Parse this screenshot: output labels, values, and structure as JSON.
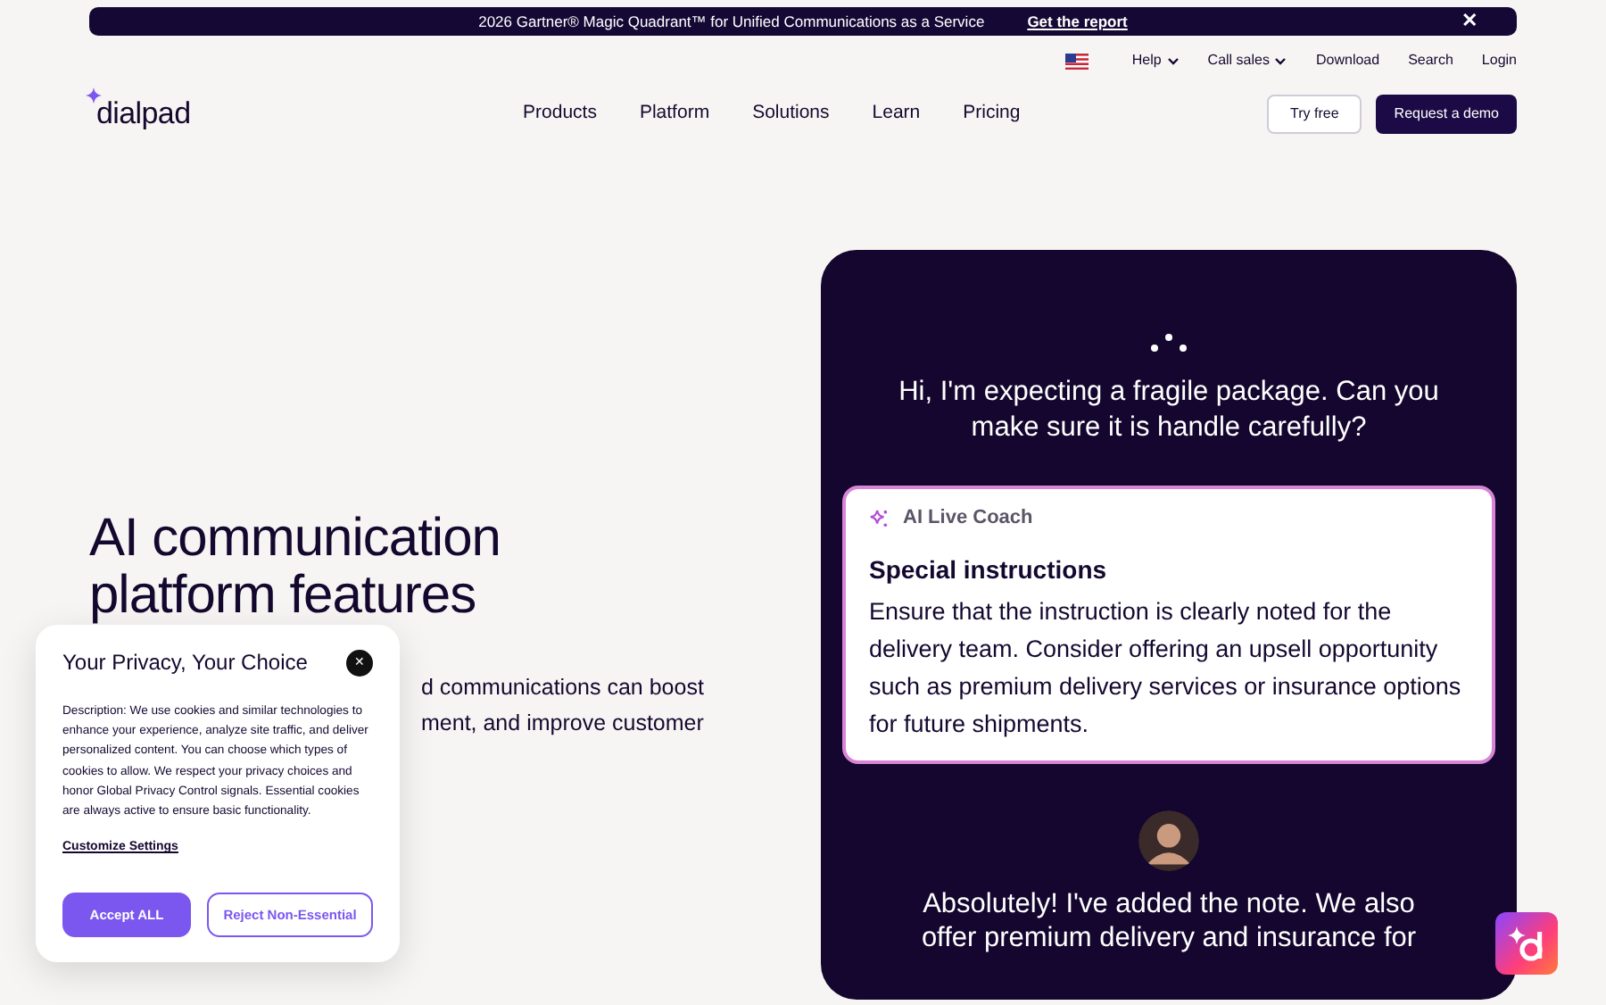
{
  "banner": {
    "text": "2026 Gartner® Magic Quadrant™ for Unified Communications as a Service",
    "link": "Get the report",
    "close": "✕"
  },
  "utility_nav": [
    {
      "label": "Help",
      "dropdown": true
    },
    {
      "label": "Call sales",
      "dropdown": true
    },
    {
      "label": "Download",
      "dropdown": false
    },
    {
      "label": "Search",
      "dropdown": false
    },
    {
      "label": "Login",
      "dropdown": false
    }
  ],
  "logo": "dialpad",
  "main_nav": [
    "Products",
    "Platform",
    "Solutions",
    "Learn",
    "Pricing"
  ],
  "actions": [
    {
      "label": "Try free",
      "kind": "outline"
    },
    {
      "label": "Request a demo",
      "kind": "solid"
    }
  ],
  "hero": {
    "title_lines": [
      "AI communication",
      "platform features"
    ],
    "paragraph_lines": [
      "d communications can boost",
      "ment, and improve customer"
    ]
  },
  "demo": {
    "customer_message": "Hi, I'm expecting a fragile package. Can you make sure it is handle carefully?",
    "coach": {
      "label": "AI Live Coach",
      "heading": "Special instructions",
      "body": "Ensure that the instruction is clearly noted for the delivery team. Consider offering an upsell opportunity such as premium delivery services or insurance options for future shipments."
    },
    "agent_message_lines": [
      "Absolutely! I've added the note. We also",
      "offer premium delivery and insurance for"
    ]
  },
  "cookie_dialog": {
    "title": "Your Privacy, Your Choice",
    "close": "✕",
    "description": "Description: We use cookies and similar technologies to enhance your experience, analyze site traffic, and deliver personalized content. You can choose which types of cookies to allow. We respect your privacy choices and honor Global Privacy Control signals. Essential cookies are always active to ensure basic functionality.",
    "link": "Customize Settings",
    "buttons": [
      {
        "label": "Accept ALL",
        "kind": "solid"
      },
      {
        "label": "Reject Non-Essential",
        "kind": "outline"
      }
    ]
  }
}
